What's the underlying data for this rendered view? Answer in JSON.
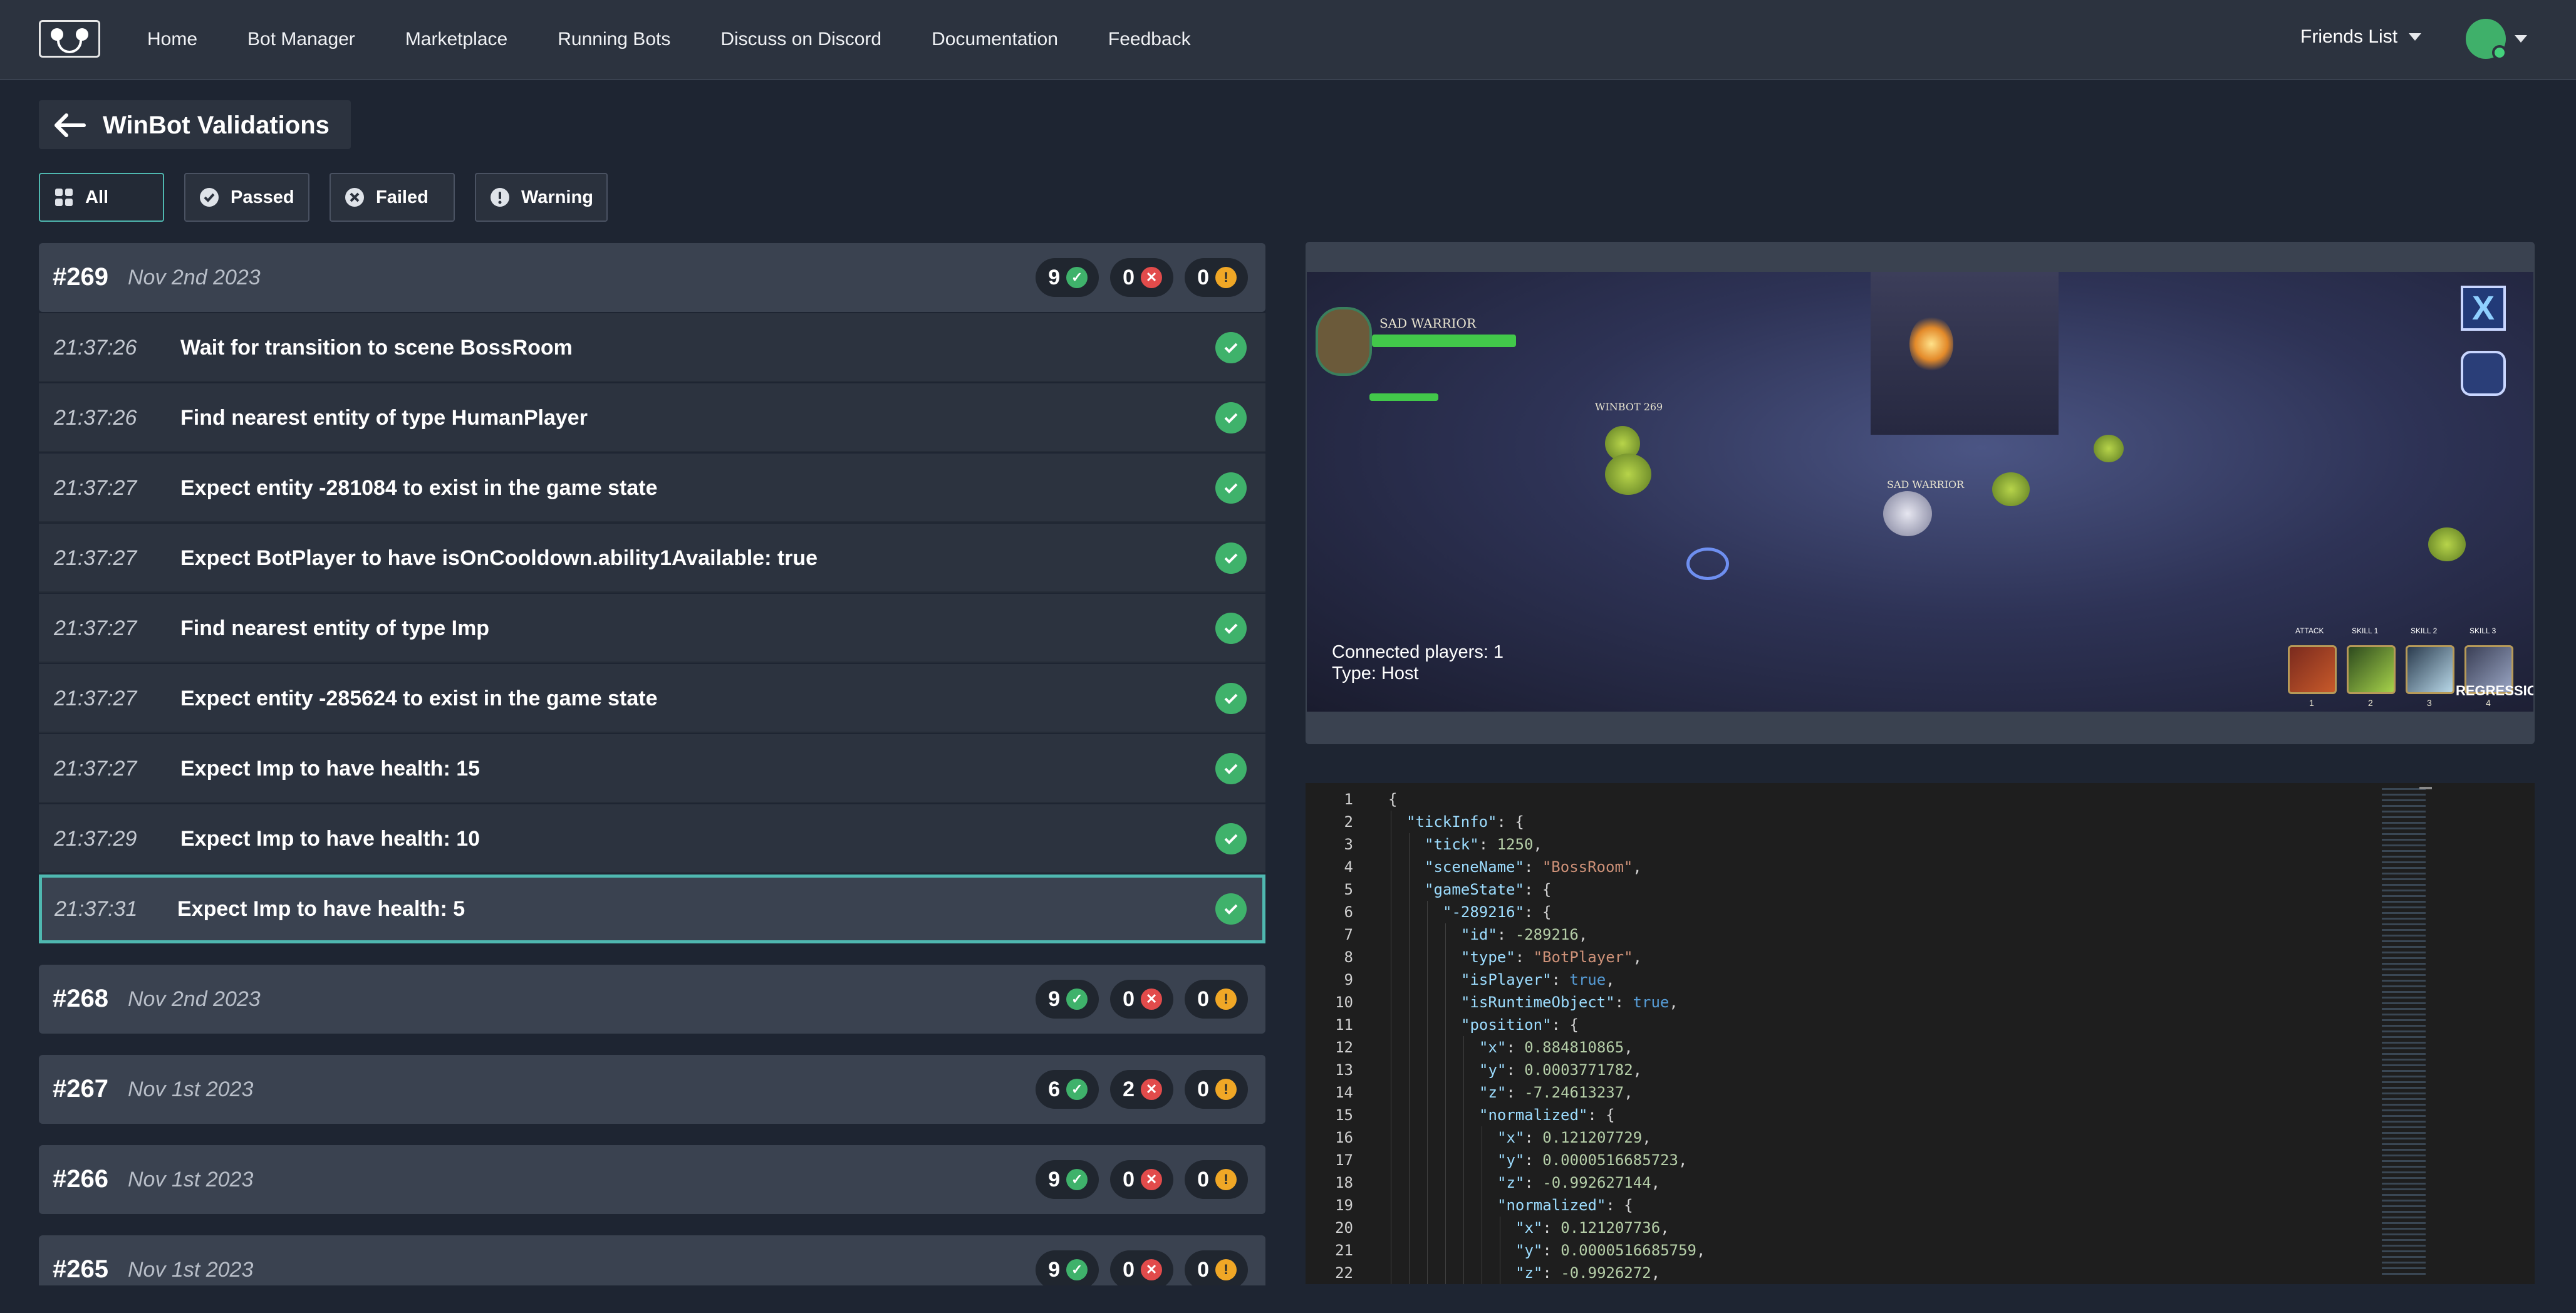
{
  "nav": {
    "links": [
      "Home",
      "Bot Manager",
      "Marketplace",
      "Running Bots",
      "Discuss on Discord",
      "Documentation",
      "Feedback"
    ],
    "friends_label": "Friends List"
  },
  "page": {
    "title": "WinBot Validations"
  },
  "filters": [
    {
      "label": "All",
      "icon": "grid-icon",
      "active": true
    },
    {
      "label": "Passed",
      "icon": "check-circle-icon",
      "active": false
    },
    {
      "label": "Failed",
      "icon": "x-circle-icon",
      "active": false
    },
    {
      "label": "Warning",
      "icon": "exclamation-circle-icon",
      "active": false
    }
  ],
  "runs": [
    {
      "id": "#269",
      "date": "Nov 2nd 2023",
      "passed": "9",
      "failed": "0",
      "warnings": "0",
      "expanded": true
    },
    {
      "id": "#268",
      "date": "Nov 2nd 2023",
      "passed": "9",
      "failed": "0",
      "warnings": "0"
    },
    {
      "id": "#267",
      "date": "Nov 1st 2023",
      "passed": "6",
      "failed": "2",
      "warnings": "0"
    },
    {
      "id": "#266",
      "date": "Nov 1st 2023",
      "passed": "9",
      "failed": "0",
      "warnings": "0"
    },
    {
      "id": "#265",
      "date": "Nov 1st 2023",
      "passed": "9",
      "failed": "0",
      "warnings": "0"
    }
  ],
  "steps": [
    {
      "time": "21:37:26",
      "text": "Wait for transition to scene BossRoom",
      "status": "passed"
    },
    {
      "time": "21:37:26",
      "text": "Find nearest entity of type HumanPlayer",
      "status": "passed"
    },
    {
      "time": "21:37:27",
      "text": "Expect entity -281084 to exist in the game state",
      "status": "passed"
    },
    {
      "time": "21:37:27",
      "text": "Expect BotPlayer to have isOnCooldown.ability1Available: true",
      "status": "passed"
    },
    {
      "time": "21:37:27",
      "text": "Find nearest entity of type Imp",
      "status": "passed"
    },
    {
      "time": "21:37:27",
      "text": "Expect entity -285624 to exist in the game state",
      "status": "passed"
    },
    {
      "time": "21:37:27",
      "text": "Expect Imp to have health: 15",
      "status": "passed"
    },
    {
      "time": "21:37:29",
      "text": "Expect Imp to have health: 10",
      "status": "passed"
    },
    {
      "time": "21:37:31",
      "text": "Expect Imp to have health: 5",
      "status": "passed",
      "selected": true
    }
  ],
  "preview": {
    "hero_name": "SAD WARRIOR",
    "bot_name": "WINBOT 269",
    "enemy_name": "SAD WARRIOR",
    "status_players": "Connected players: 1",
    "status_type": "Type: Host",
    "skill_labels": [
      "ATTACK",
      "SKILL 1",
      "SKILL 2",
      "SKILL 3"
    ],
    "skill_numbers": [
      "1",
      "2",
      "3",
      "4"
    ],
    "regression_label": "REGRESSION",
    "close_glyph": "X"
  },
  "json_lines": [
    {
      "n": "1",
      "indent": 0,
      "tokens": [
        [
          "p",
          "{"
        ]
      ]
    },
    {
      "n": "2",
      "indent": 1,
      "tokens": [
        [
          "k",
          "\"tickInfo\""
        ],
        [
          "p",
          ": {"
        ]
      ]
    },
    {
      "n": "3",
      "indent": 2,
      "tokens": [
        [
          "k",
          "\"tick\""
        ],
        [
          "p",
          ": "
        ],
        [
          "num",
          "1250"
        ],
        [
          "p",
          ","
        ]
      ]
    },
    {
      "n": "4",
      "indent": 2,
      "tokens": [
        [
          "k",
          "\"sceneName\""
        ],
        [
          "p",
          ": "
        ],
        [
          "s",
          "\"BossRoom\""
        ],
        [
          "p",
          ","
        ]
      ]
    },
    {
      "n": "5",
      "indent": 2,
      "tokens": [
        [
          "k",
          "\"gameState\""
        ],
        [
          "p",
          ": {"
        ]
      ]
    },
    {
      "n": "6",
      "indent": 3,
      "tokens": [
        [
          "k",
          "\"-289216\""
        ],
        [
          "p",
          ": {"
        ]
      ]
    },
    {
      "n": "7",
      "indent": 4,
      "tokens": [
        [
          "k",
          "\"id\""
        ],
        [
          "p",
          ": "
        ],
        [
          "num",
          "-289216"
        ],
        [
          "p",
          ","
        ]
      ]
    },
    {
      "n": "8",
      "indent": 4,
      "tokens": [
        [
          "k",
          "\"type\""
        ],
        [
          "p",
          ": "
        ],
        [
          "s",
          "\"BotPlayer\""
        ],
        [
          "p",
          ","
        ]
      ]
    },
    {
      "n": "9",
      "indent": 4,
      "tokens": [
        [
          "k",
          "\"isPlayer\""
        ],
        [
          "p",
          ": "
        ],
        [
          "b",
          "true"
        ],
        [
          "p",
          ","
        ]
      ]
    },
    {
      "n": "10",
      "indent": 4,
      "tokens": [
        [
          "k",
          "\"isRuntimeObject\""
        ],
        [
          "p",
          ": "
        ],
        [
          "b",
          "true"
        ],
        [
          "p",
          ","
        ]
      ]
    },
    {
      "n": "11",
      "indent": 4,
      "tokens": [
        [
          "k",
          "\"position\""
        ],
        [
          "p",
          ": {"
        ]
      ]
    },
    {
      "n": "12",
      "indent": 5,
      "tokens": [
        [
          "k",
          "\"x\""
        ],
        [
          "p",
          ": "
        ],
        [
          "num",
          "0.884810865"
        ],
        [
          "p",
          ","
        ]
      ]
    },
    {
      "n": "13",
      "indent": 5,
      "tokens": [
        [
          "k",
          "\"y\""
        ],
        [
          "p",
          ": "
        ],
        [
          "num",
          "0.0003771782"
        ],
        [
          "p",
          ","
        ]
      ]
    },
    {
      "n": "14",
      "indent": 5,
      "tokens": [
        [
          "k",
          "\"z\""
        ],
        [
          "p",
          ": "
        ],
        [
          "num",
          "-7.24613237"
        ],
        [
          "p",
          ","
        ]
      ]
    },
    {
      "n": "15",
      "indent": 5,
      "tokens": [
        [
          "k",
          "\"normalized\""
        ],
        [
          "p",
          ": {"
        ]
      ]
    },
    {
      "n": "16",
      "indent": 6,
      "tokens": [
        [
          "k",
          "\"x\""
        ],
        [
          "p",
          ": "
        ],
        [
          "num",
          "0.121207729"
        ],
        [
          "p",
          ","
        ]
      ]
    },
    {
      "n": "17",
      "indent": 6,
      "tokens": [
        [
          "k",
          "\"y\""
        ],
        [
          "p",
          ": "
        ],
        [
          "num",
          "0.0000516685723"
        ],
        [
          "p",
          ","
        ]
      ]
    },
    {
      "n": "18",
      "indent": 6,
      "tokens": [
        [
          "k",
          "\"z\""
        ],
        [
          "p",
          ": "
        ],
        [
          "num",
          "-0.992627144"
        ],
        [
          "p",
          ","
        ]
      ]
    },
    {
      "n": "19",
      "indent": 6,
      "tokens": [
        [
          "k",
          "\"normalized\""
        ],
        [
          "p",
          ": {"
        ]
      ]
    },
    {
      "n": "20",
      "indent": 7,
      "tokens": [
        [
          "k",
          "\"x\""
        ],
        [
          "p",
          ": "
        ],
        [
          "num",
          "0.121207736"
        ],
        [
          "p",
          ","
        ]
      ]
    },
    {
      "n": "21",
      "indent": 7,
      "tokens": [
        [
          "k",
          "\"y\""
        ],
        [
          "p",
          ": "
        ],
        [
          "num",
          "0.0000516685759"
        ],
        [
          "p",
          ","
        ]
      ]
    },
    {
      "n": "22",
      "indent": 7,
      "tokens": [
        [
          "k",
          "\"z\""
        ],
        [
          "p",
          ": "
        ],
        [
          "num",
          "-0.9926272"
        ],
        [
          "p",
          ","
        ]
      ]
    }
  ],
  "colors": {
    "accent": "#4fb8b0",
    "passed": "#3fb26b",
    "failed": "#e24b4b",
    "warning": "#f0a726"
  }
}
